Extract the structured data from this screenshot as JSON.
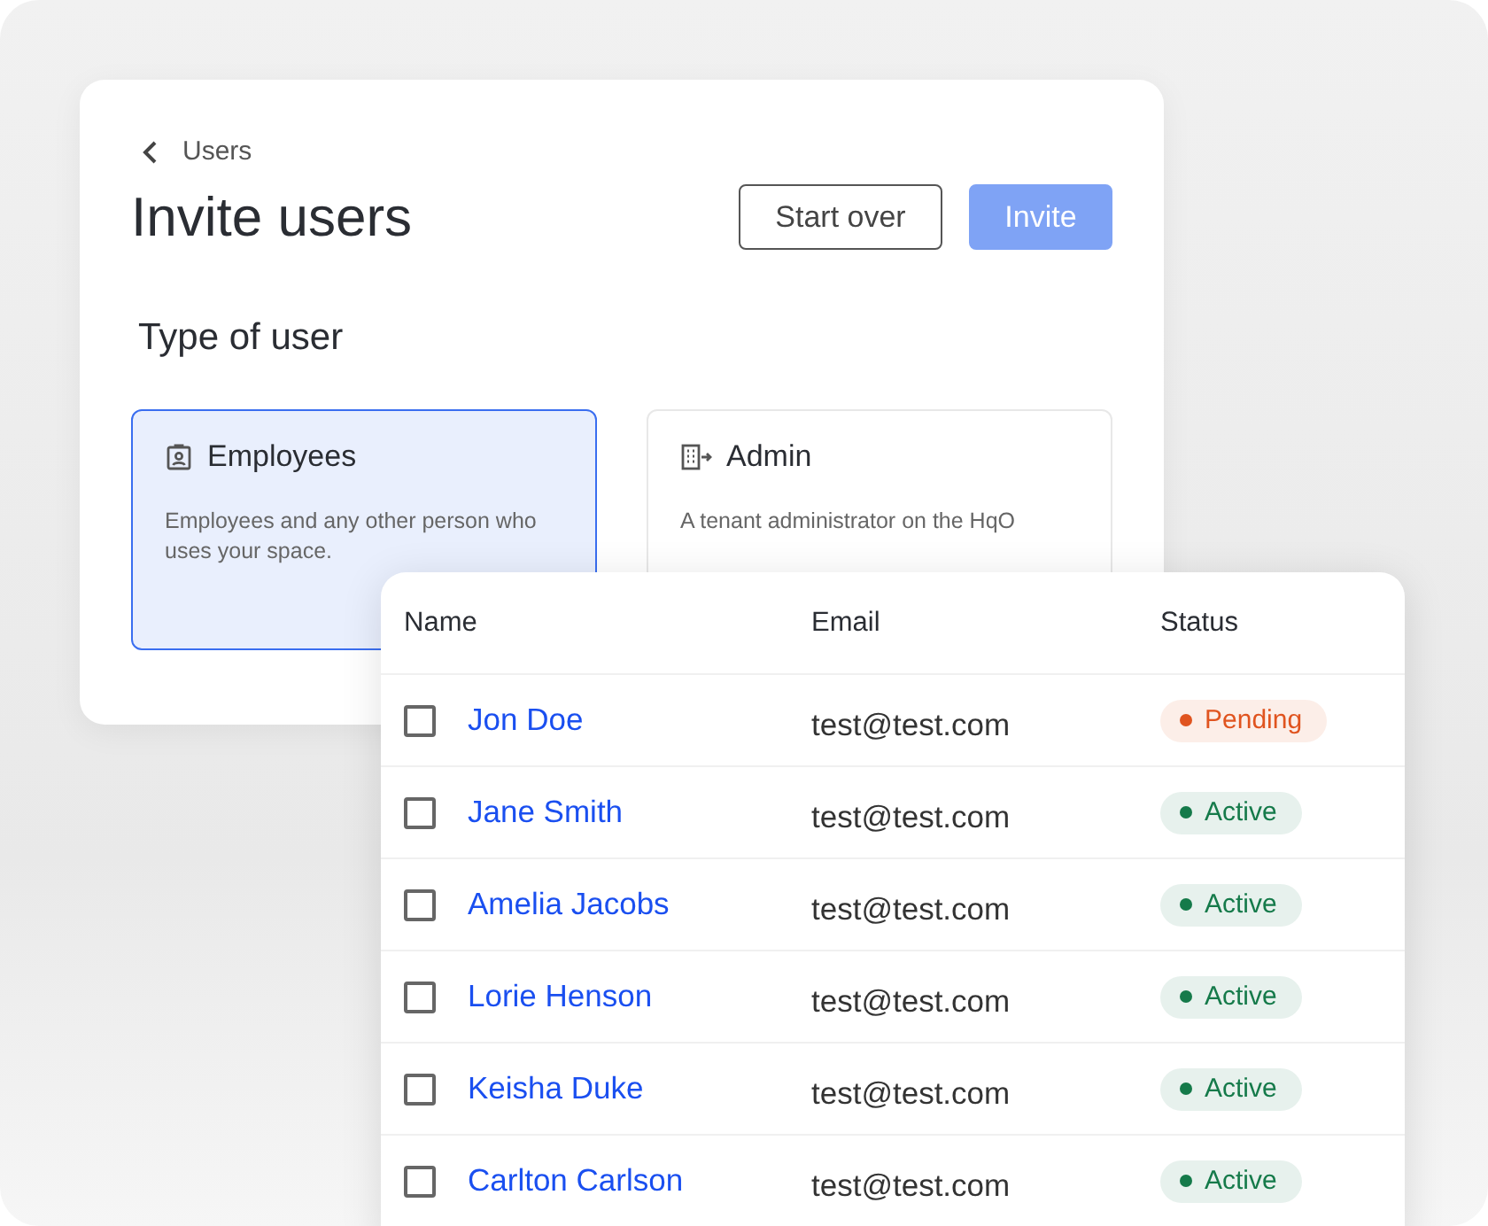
{
  "breadcrumb": {
    "label": "Users"
  },
  "title": "Invite users",
  "actions": [
    {
      "label": "Start over",
      "kind": "secondary"
    },
    {
      "label": "Invite",
      "kind": "primary"
    }
  ],
  "section_title": "Type of user",
  "user_types": [
    {
      "label": "Employees",
      "kind": "badge",
      "selected": true,
      "description": "Employees and any other person who uses your space."
    },
    {
      "label": "Admin",
      "kind": "building",
      "selected": false,
      "description": "A tenant administrator on the HqO"
    }
  ],
  "table": {
    "columns": [
      "Name",
      "Email",
      "Status"
    ],
    "rows": [
      {
        "name": "Jon Doe",
        "email": "test@test.com",
        "status": "Pending",
        "color": "#e0541f",
        "checked": false
      },
      {
        "name": "Jane Smith",
        "email": "test@test.com",
        "status": "Active",
        "color": "#157a4a",
        "checked": false
      },
      {
        "name": "Amelia Jacobs",
        "email": "test@test.com",
        "status": "Active",
        "color": "#157a4a",
        "checked": false
      },
      {
        "name": "Lorie Henson",
        "email": "test@test.com",
        "status": "Active",
        "color": "#157a4a",
        "checked": false
      },
      {
        "name": "Keisha Duke",
        "email": "test@test.com",
        "status": "Active",
        "color": "#157a4a",
        "checked": false
      },
      {
        "name": "Carlton Carlson",
        "email": "test@test.com",
        "status": "Active",
        "color": "#157a4a",
        "checked": false
      }
    ]
  }
}
